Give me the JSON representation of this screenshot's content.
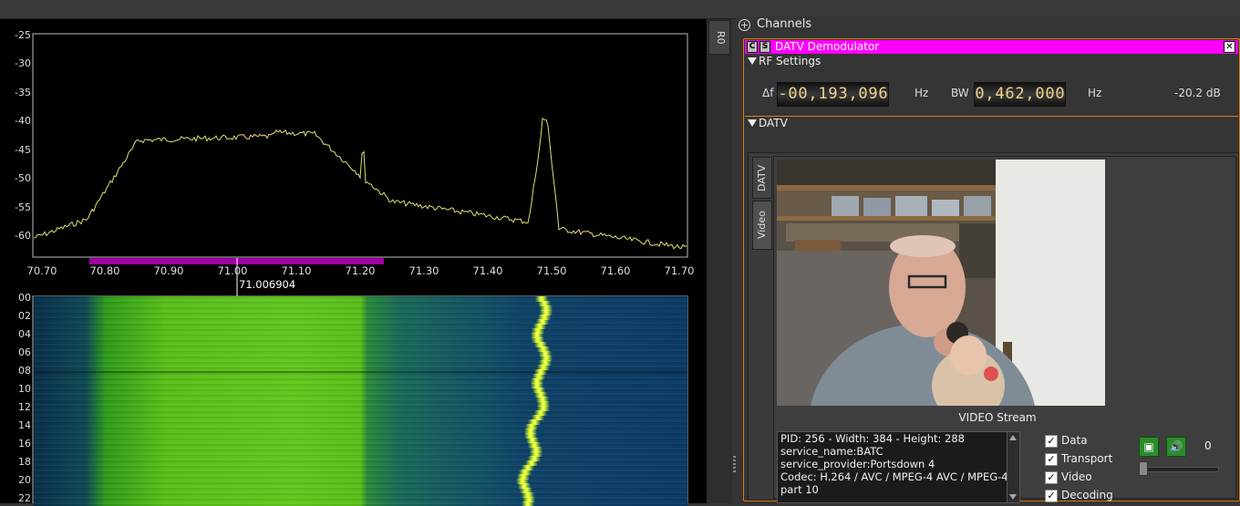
{
  "spectrum": {
    "y_labels": [
      "-25",
      "-30",
      "-35",
      "-40",
      "-45",
      "-50",
      "-55",
      "-60"
    ],
    "x_labels": [
      "70.70",
      "70.80",
      "70.90",
      "71.00",
      "71.10",
      "71.20",
      "71.30",
      "71.40",
      "71.50",
      "71.60",
      "71.70"
    ],
    "cursor_freq": "71.006904",
    "trace_color": "#e0e070",
    "channel_marker_color": "#a000a0"
  },
  "waterfall": {
    "time_labels": [
      "00",
      "02",
      "04",
      "06",
      "08",
      "10",
      "12",
      "14",
      "16",
      "18",
      "20",
      "22"
    ]
  },
  "splitter": {
    "tab": "R0"
  },
  "channels": {
    "title": "Channels",
    "demod": {
      "c_btn": "C",
      "s_btn": "S",
      "name": "DATV Demodulator",
      "title_color": "#ff00ff",
      "rf": {
        "header": "RF Settings",
        "delta_label": "Δf",
        "delta_digits": [
          "-",
          "0",
          "0",
          ",",
          "1",
          "9",
          "3",
          ",",
          "0",
          "9",
          "6"
        ],
        "hz1": "Hz",
        "bw_label": "BW",
        "bw_digits": [
          "0",
          ",",
          "4",
          "6",
          "2",
          ",",
          "0",
          "0",
          "0"
        ],
        "hz2": "Hz",
        "power": "-20.2 dB"
      },
      "datv": {
        "header": "DATV",
        "tabs": [
          "DATV",
          "Video"
        ],
        "stream_label": "VIDEO Stream",
        "info": [
          "PID: 256 - Width: 384 - Height: 288",
          "service_name:BATC",
          "service_provider:Portsdown 4",
          "Codec: H.264 / AVC / MPEG-4 AVC / MPEG-4",
          "part 10"
        ],
        "checks": [
          "Data",
          "Transport",
          "Video",
          "Decoding"
        ],
        "volume": "0"
      }
    }
  }
}
